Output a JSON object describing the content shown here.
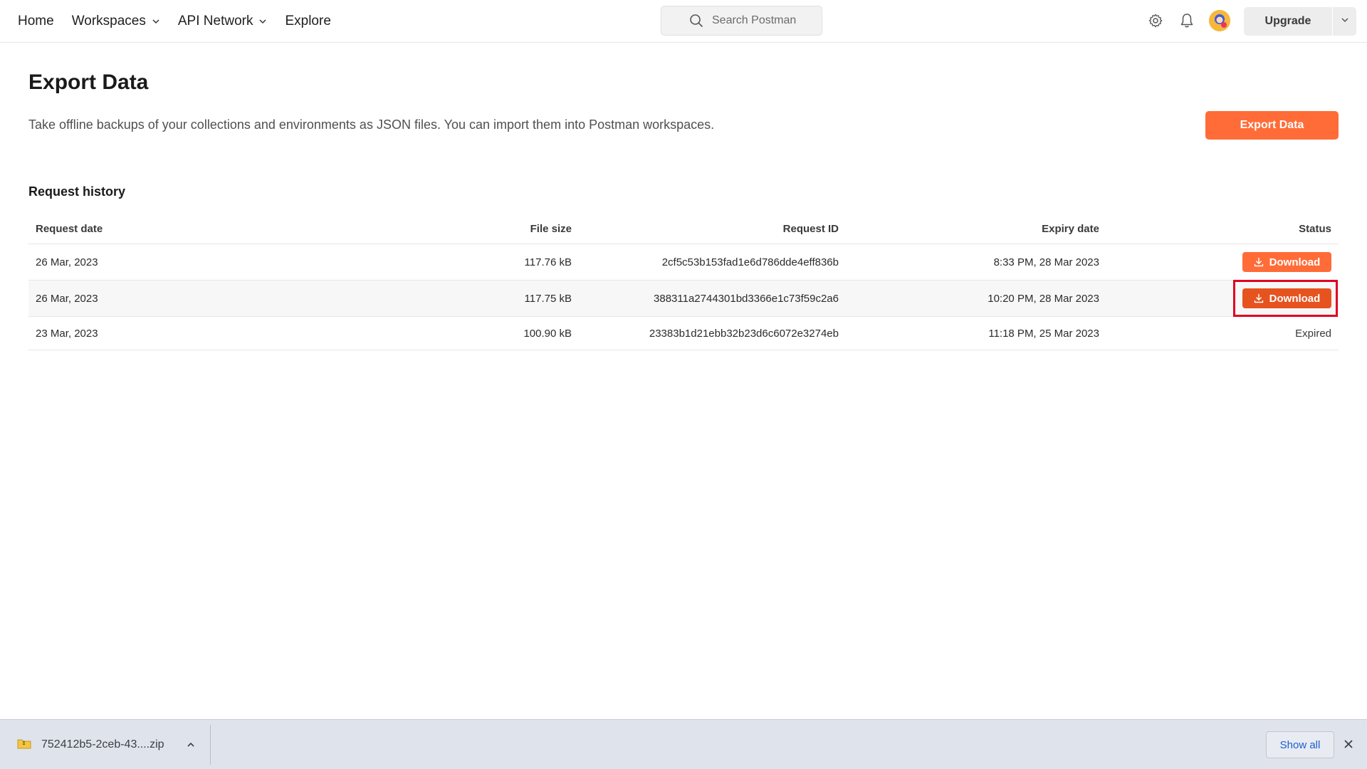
{
  "nav": {
    "home": "Home",
    "workspaces": "Workspaces",
    "api_network": "API Network",
    "explore": "Explore"
  },
  "search": {
    "placeholder": "Search Postman"
  },
  "header_actions": {
    "settings_icon": "gear-icon",
    "notifications_icon": "bell-icon",
    "upgrade_label": "Upgrade"
  },
  "page": {
    "title": "Export Data",
    "description": "Take offline backups of your collections and environments as JSON files. You can import them into Postman workspaces.",
    "export_button": "Export Data",
    "section_title": "Request history"
  },
  "table": {
    "columns": [
      "Request date",
      "File size",
      "Request ID",
      "Expiry date",
      "Status"
    ],
    "rows": [
      {
        "date": "26 Mar, 2023",
        "size": "117.76 kB",
        "id": "2cf5c53b153fad1e6d786dde4eff836b",
        "expiry": "8:33 PM, 28 Mar 2023",
        "status": "Download"
      },
      {
        "date": "26 Mar, 2023",
        "size": "117.75 kB",
        "id": "388311a2744301bd3366e1c73f59c2a6",
        "expiry": "10:20 PM, 28 Mar 2023",
        "status": "Download"
      },
      {
        "date": "23 Mar, 2023",
        "size": "100.90 kB",
        "id": "23383b1d21ebb32b23d6c6072e3274eb",
        "expiry": "11:18 PM, 25 Mar 2023",
        "status": "Expired"
      }
    ]
  },
  "download_shelf": {
    "file_name": "752412b5-2ceb-43....zip",
    "show_all": "Show all"
  },
  "colors": {
    "accent": "#ff6c37",
    "accent_active": "#e6531f",
    "highlight": "#e00020",
    "shelf_bg": "#dfe3ec",
    "link": "#1a5fd0"
  }
}
